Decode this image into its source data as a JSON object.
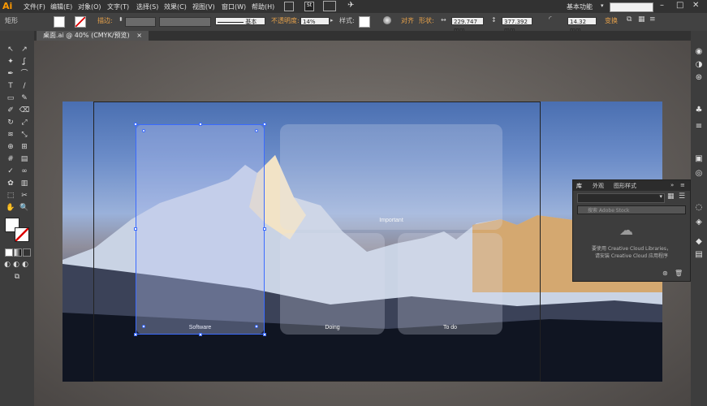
{
  "app": {
    "logo": "Ai",
    "workspace": "基本功能"
  },
  "menu": [
    "文件(F)",
    "编辑(E)",
    "对象(O)",
    "文字(T)",
    "选择(S)",
    "效果(C)",
    "视图(V)",
    "窗口(W)",
    "帮助(H)"
  ],
  "window_controls": {
    "minimize": "–",
    "maximize": "□",
    "close": "✕"
  },
  "control_bar": {
    "shape_label": "矩形",
    "stroke_label": "描边:",
    "stroke_profile": "基本",
    "opacity_label": "不透明度:",
    "opacity_value": "14%",
    "style_label": "样式:",
    "align_label": "对齐",
    "shape_props_label": "形状:",
    "width_value": "229.747 mm",
    "height_value": "377.392 mm",
    "corner_value": "14.32 mm",
    "transform_label": "变换"
  },
  "document_tab": {
    "title": "桌面.ai @ 40% (CMYK/预览)",
    "close": "×"
  },
  "artboard": {
    "cards": [
      {
        "label": "Software"
      },
      {
        "label": "Important"
      },
      {
        "label": "Doing"
      },
      {
        "label": "To do"
      }
    ]
  },
  "libraries_panel": {
    "tabs": [
      "库",
      "外观",
      "图形样式"
    ],
    "search_placeholder": "搜索 Adobe Stock",
    "message_line1": "要使用 Creative Cloud Libraries，",
    "message_line2": "请安装 Creative Cloud 应用程序"
  },
  "icons": {
    "tools": [
      "selection-tool",
      "direct-selection-tool",
      "magic-wand-tool",
      "lasso-tool",
      "pen-tool",
      "curvature-tool",
      "type-tool",
      "line-tool",
      "rectangle-tool",
      "paintbrush-tool",
      "shaper-tool",
      "eraser-tool",
      "rotate-tool",
      "scale-tool",
      "width-tool",
      "free-transform-tool",
      "shape-builder-tool",
      "perspective-tool",
      "mesh-tool",
      "gradient-tool",
      "eyedropper-tool",
      "blend-tool",
      "symbol-sprayer-tool",
      "column-graph-tool",
      "artboard-tool",
      "slice-tool",
      "hand-tool",
      "zoom-tool"
    ],
    "dock": [
      "color-icon",
      "color-guide-icon",
      "brushes-icon",
      "symbols-icon",
      "stroke-icon",
      "gradient-icon",
      "transparency-icon",
      "appearance-icon",
      "graphic-styles-icon",
      "layers-icon",
      "artboards-icon"
    ]
  },
  "colors": {
    "accent": "#3b6bff",
    "orange_label": "#e8a24a",
    "logo": "#ff9a00"
  }
}
